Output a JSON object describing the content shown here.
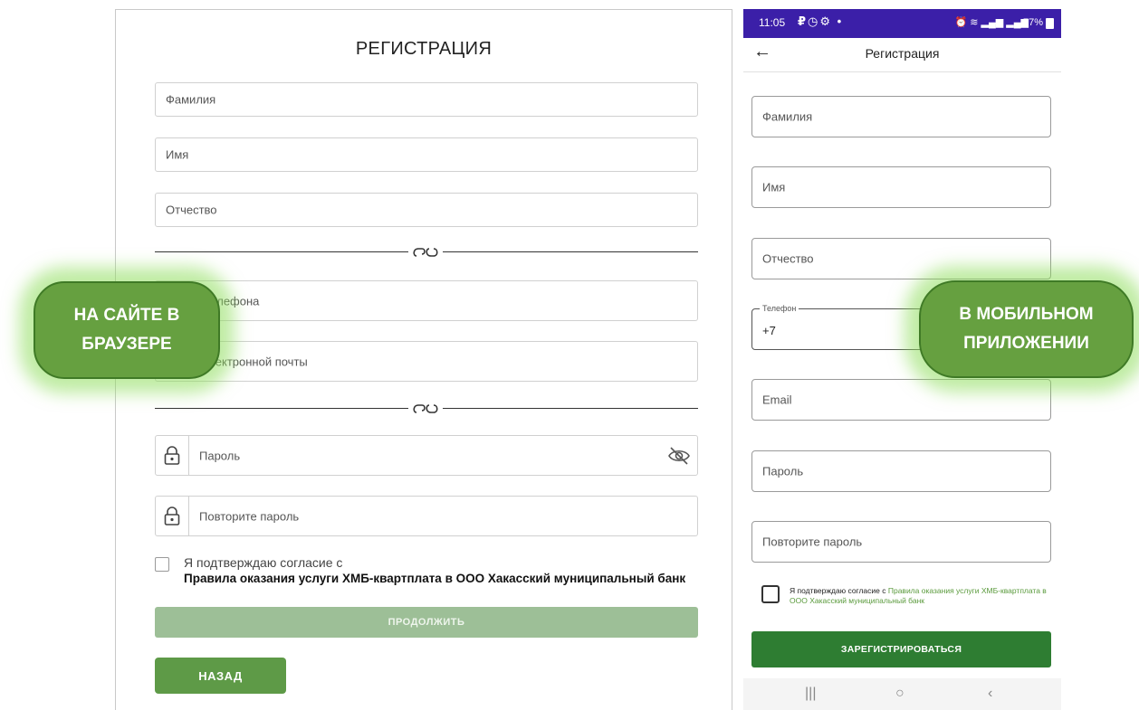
{
  "web": {
    "title": "РЕГИСТРАЦИЯ",
    "fields": {
      "last_name": "Фамилия",
      "first_name": "Имя",
      "patronymic": "Отчество",
      "phone": "Номер телефона",
      "email": "Адрес электронной почты",
      "password": "Пароль",
      "repeat_password": "Повторите пароль"
    },
    "consent_line1": "Я подтверждаю согласие с",
    "consent_line2": "Правила оказания услуги ХМБ-квартплата в ООО Хакасский муниципальный банк",
    "continue_label": "ПРОДОЛЖИТЬ",
    "back_label": "НАЗАД",
    "colors": {
      "continue_disabled": "#9dbf97",
      "back": "#5e9a47"
    }
  },
  "phone": {
    "status": {
      "time": "11:05",
      "battery": "77%"
    },
    "appbar_title": "Регистрация",
    "fields": {
      "last_name": "Фамилия",
      "first_name": "Имя",
      "patronymic": "Отчество",
      "phone_label": "Телефон",
      "phone_value": "+7",
      "email": "Email",
      "password": "Пароль",
      "repeat_password": "Повторите пароль"
    },
    "consent_text": "Я подтверждаю согласие с ",
    "consent_link": "Правила оказания услуги ХМБ-квартплата в ООО Хакасский муниципальный банк",
    "register_label": "ЗАРЕГИСТРИРОВАТЬСЯ",
    "colors": {
      "statusbar": "#3b1fa8",
      "register": "#2e7d32",
      "link": "#5a9a3c"
    }
  },
  "overlays": {
    "web_label_line1": "НА САЙТЕ В",
    "web_label_line2": "БРАУЗЕРЕ",
    "phone_label_line1": "В МОБИЛЬНОМ",
    "phone_label_line2": "ПРИЛОЖЕНИИ",
    "color": "#66a040"
  }
}
